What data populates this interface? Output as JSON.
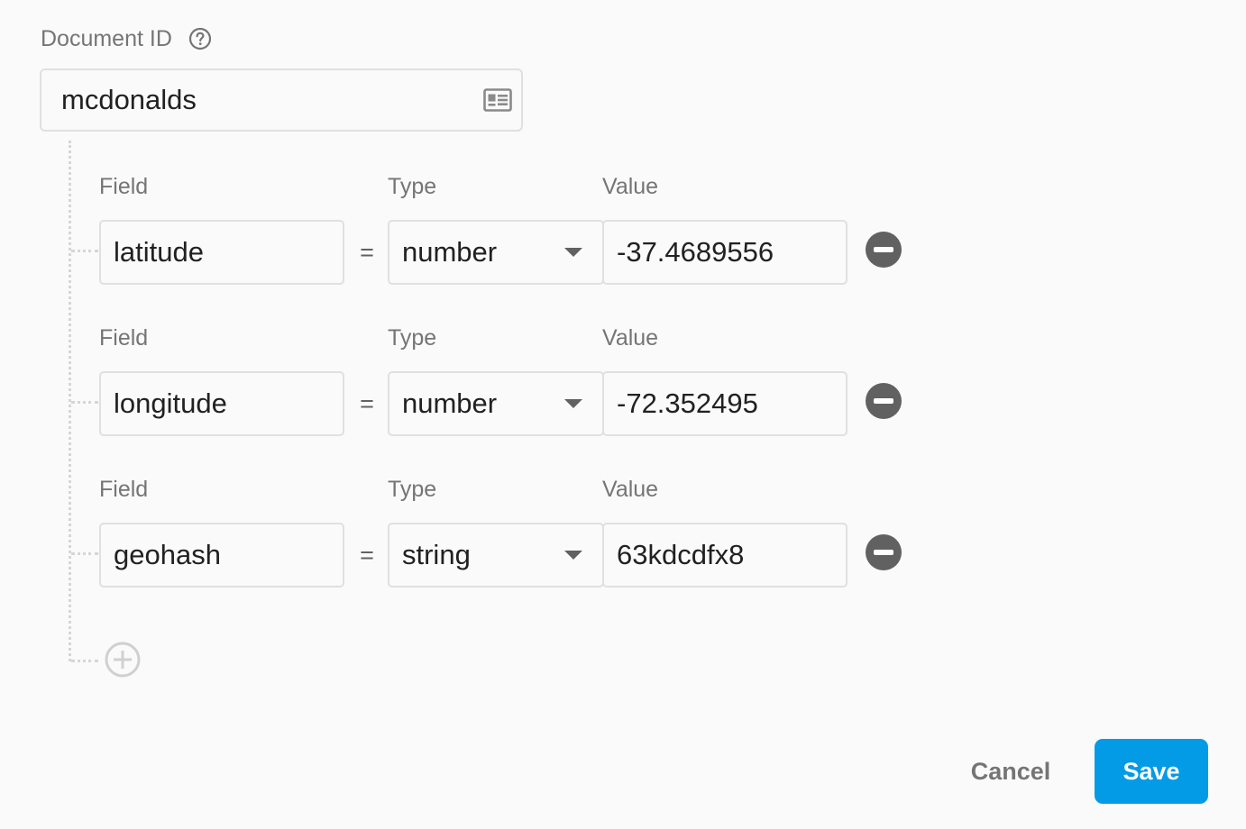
{
  "document": {
    "label": "Document ID",
    "id_value": "mcdonalds",
    "help_icon": "help-circle-icon",
    "id_icon": "id-card-icon"
  },
  "fields": [
    {
      "field_label": "Field",
      "type_label": "Type",
      "value_label": "Value",
      "name": "latitude",
      "equals": "=",
      "type": "number",
      "value": "-37.4689556"
    },
    {
      "field_label": "Field",
      "type_label": "Type",
      "value_label": "Value",
      "name": "longitude",
      "equals": "=",
      "type": "number",
      "value": "-72.352495"
    },
    {
      "field_label": "Field",
      "type_label": "Type",
      "value_label": "Value",
      "name": "geohash",
      "equals": "=",
      "type": "string",
      "value": "63kdcdfx8"
    }
  ],
  "actions": {
    "cancel_label": "Cancel",
    "save_label": "Save",
    "add_icon": "add-circle-icon",
    "remove_icon": "remove-circle-icon"
  },
  "colors": {
    "primary": "#039be5",
    "remove_button": "#616161",
    "text": "#212121",
    "label": "#757575",
    "border": "#e0e0e0"
  }
}
